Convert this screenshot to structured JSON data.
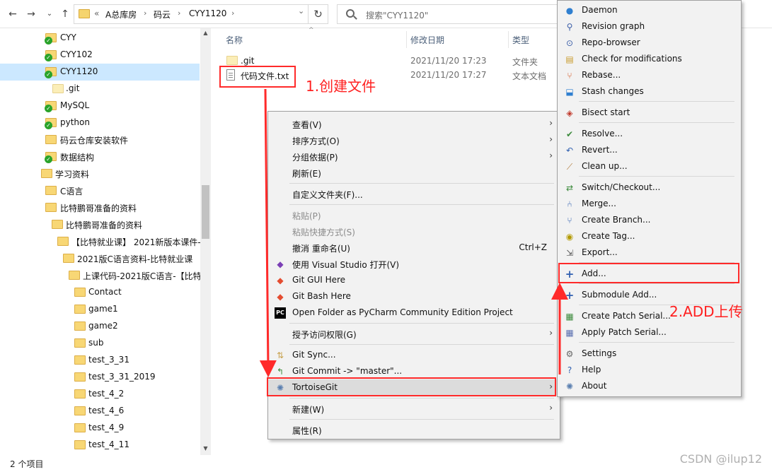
{
  "toolbar": {
    "back_icon": "back-arrow-icon",
    "forward_icon": "forward-arrow-icon",
    "recent_icon": "chevron-down-icon",
    "up_icon": "up-arrow-icon"
  },
  "address": {
    "overflow": "«",
    "crumbs": [
      "A总库房",
      "码云",
      "CYY1120"
    ],
    "separator": "›",
    "dropdown": "⌄"
  },
  "refresh_glyph": "↻",
  "search": {
    "placeholder": "搜索\"CYY1120\""
  },
  "tree": {
    "items": [
      {
        "label": "CYY"
      },
      {
        "label": "CYY102"
      },
      {
        "label": "CYY1120"
      },
      {
        "label": ".git"
      },
      {
        "label": "MySQL"
      },
      {
        "label": "python"
      },
      {
        "label": "码云仓库安装软件"
      },
      {
        "label": "数据结构"
      },
      {
        "label": "学习资料"
      },
      {
        "label": "C语言"
      },
      {
        "label": "比特鹏哥准备的资料"
      },
      {
        "label": "比特鹏哥准备的资料"
      },
      {
        "label": "【比特就业课】 2021新版本课件-"
      },
      {
        "label": "2021版C语言资料-比特就业课"
      },
      {
        "label": "上课代码-2021版C语言-【比特"
      },
      {
        "label": "Contact"
      },
      {
        "label": "game1"
      },
      {
        "label": "game2"
      },
      {
        "label": "sub"
      },
      {
        "label": "test_3_31"
      },
      {
        "label": "test_3_31_2019"
      },
      {
        "label": "test_4_2"
      },
      {
        "label": "test_4_6"
      },
      {
        "label": "test_4_9"
      },
      {
        "label": "test_4_11"
      }
    ],
    "check": "✓"
  },
  "status": {
    "count": "2 个项目"
  },
  "columns": {
    "name": "名称",
    "date": "修改日期",
    "type": "类型"
  },
  "files": [
    {
      "name": ".git",
      "date": "2021/11/20 17:23",
      "type": "文件夹"
    },
    {
      "name": "代码文件.txt",
      "date": "2021/11/20 17:27",
      "type": "文本文档"
    }
  ],
  "context_menu": {
    "items": [
      {
        "label": "查看(V)",
        "arrow": "›"
      },
      {
        "label": "排序方式(O)",
        "arrow": "›"
      },
      {
        "label": "分组依据(P)",
        "arrow": "›"
      },
      {
        "label": "刷新(E)"
      },
      {
        "label": "自定义文件夹(F)..."
      },
      {
        "label": "粘贴(P)"
      },
      {
        "label": "粘贴快捷方式(S)"
      },
      {
        "label": "撤消 重命名(U)",
        "shortcut": "Ctrl+Z"
      },
      {
        "label": "使用 Visual Studio 打开(V)"
      },
      {
        "label": "Git GUI Here"
      },
      {
        "label": "Git Bash Here"
      },
      {
        "label": "Open Folder as PyCharm Community Edition Project"
      },
      {
        "label": "授予访问权限(G)",
        "arrow": "›"
      },
      {
        "label": "Git Sync..."
      },
      {
        "label": "Git Commit -> \"master\"..."
      },
      {
        "label": "TortoiseGit",
        "arrow": "›"
      },
      {
        "label": "新建(W)",
        "arrow": "›"
      },
      {
        "label": "属性(R)"
      }
    ],
    "pycharm_badge": "PC"
  },
  "tortoise_menu": {
    "items": [
      {
        "label": "Daemon"
      },
      {
        "label": "Revision graph"
      },
      {
        "label": "Repo-browser"
      },
      {
        "label": "Check for modifications"
      },
      {
        "label": "Rebase..."
      },
      {
        "label": "Stash changes"
      },
      {
        "label": "Bisect start"
      },
      {
        "label": "Resolve..."
      },
      {
        "label": "Revert..."
      },
      {
        "label": "Clean up..."
      },
      {
        "label": "Switch/Checkout..."
      },
      {
        "label": "Merge..."
      },
      {
        "label": "Create Branch..."
      },
      {
        "label": "Create Tag..."
      },
      {
        "label": "Export..."
      },
      {
        "label": "Add..."
      },
      {
        "label": "Submodule Add..."
      },
      {
        "label": "Create Patch Serial..."
      },
      {
        "label": "Apply Patch Serial..."
      },
      {
        "label": "Settings"
      },
      {
        "label": "Help"
      },
      {
        "label": "About"
      }
    ]
  },
  "annotations": {
    "step1": "1.创建文件",
    "step2": "2.ADD上传"
  },
  "watermark": "CSDN @ilup12",
  "colors": {
    "annotation_red": "#ff2a2a",
    "selection": "#cce8ff",
    "folder": "#f8d775"
  }
}
